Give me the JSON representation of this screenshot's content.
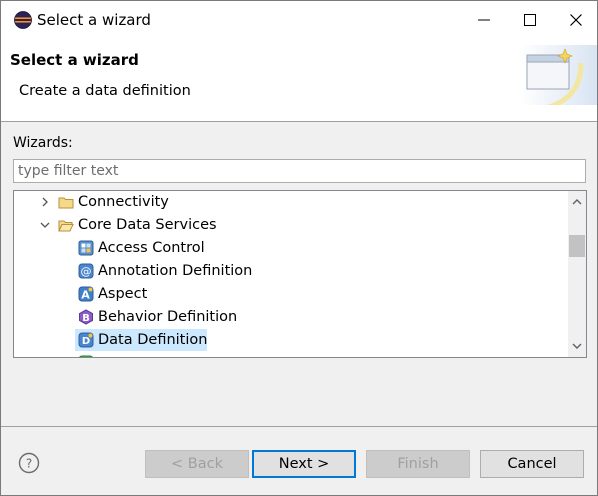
{
  "window": {
    "title": "Select a wizard"
  },
  "header": {
    "title": "Select a wizard",
    "description": "Create a data definition"
  },
  "wizards": {
    "label": "Wizards:",
    "filter_placeholder": "type filter text",
    "tree": [
      {
        "label": "Connectivity",
        "level": 1,
        "expanded": false,
        "icon": "folder-icon"
      },
      {
        "label": "Core Data Services",
        "level": 1,
        "expanded": true,
        "icon": "folder-open-icon"
      },
      {
        "label": "Access Control",
        "level": 2,
        "icon": "access-control-icon"
      },
      {
        "label": "Annotation Definition",
        "level": 2,
        "icon": "annotation-definition-icon"
      },
      {
        "label": "Aspect",
        "level": 2,
        "icon": "aspect-icon"
      },
      {
        "label": "Behavior Definition",
        "level": 2,
        "icon": "behavior-definition-icon"
      },
      {
        "label": "Data Definition",
        "level": 2,
        "icon": "data-definition-icon",
        "selected": true
      }
    ]
  },
  "buttons": {
    "back": "< Back",
    "next": "Next >",
    "finish": "Finish",
    "cancel": "Cancel"
  },
  "colors": {
    "selection": "#cce8ff",
    "default_button_border": "#0078d7"
  }
}
